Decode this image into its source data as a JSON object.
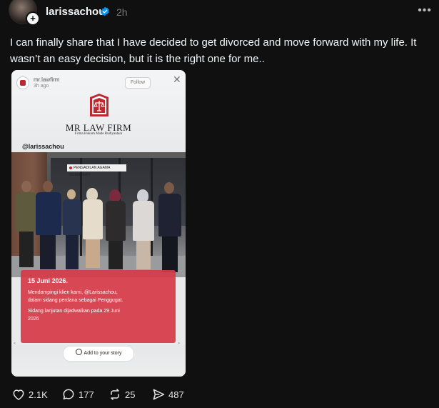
{
  "post": {
    "username": "larissachou",
    "time": "2h",
    "more_label": "•••",
    "avatar_plus": "+",
    "caption": "I can finally share that I have decided to get divorced and move forward with my life. It wasn’t an easy decision, but it is the right one for me.."
  },
  "story": {
    "account": "mr.lawfirm",
    "age": "3h ago",
    "follow_label": "Follow",
    "close": "✕",
    "firm_name": "MR LAW FIRM",
    "firm_sub": "Firma Hukum Made Rudiyantara",
    "tag_handle": "@larissachou",
    "sign_text": "PENGADILAN AGAMA NGAMPRAH",
    "date": "15 Juni 2026.",
    "lines": [
      "Mendampingi klien kami, @Larissachou,",
      "dalam sidang perdana sebagai Penggugat.",
      "Sidang lanjutan dijadwalkan pada 29 Juni",
      "2026"
    ],
    "add_story_label": "Add to your story",
    "tiny_left": "<",
    "tiny_right": ">"
  },
  "actions": {
    "likes": "2.1K",
    "comments": "177",
    "reposts": "25",
    "shares": "487"
  },
  "colors": {
    "background": "#101010",
    "text": "#f3f5f7",
    "muted": "#777777",
    "verified": "#0095f6",
    "info_box": "#d63a48"
  },
  "icons": [
    "verified-badge-icon",
    "plus-icon",
    "more-icon",
    "close-icon",
    "heart-icon",
    "comment-icon",
    "repost-icon",
    "share-icon",
    "story-add-icon",
    "scales-logo-icon"
  ]
}
